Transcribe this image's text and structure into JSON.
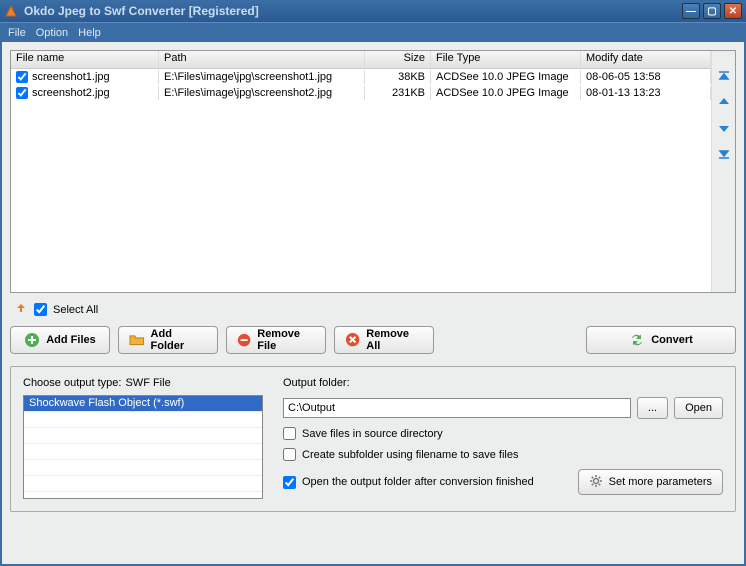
{
  "title": "Okdo Jpeg to Swf Converter [Registered]",
  "menu": {
    "file": "File",
    "option": "Option",
    "help": "Help"
  },
  "table": {
    "headers": {
      "name": "File name",
      "path": "Path",
      "size": "Size",
      "type": "File Type",
      "date": "Modify date"
    },
    "rows": [
      {
        "checked": true,
        "name": "screenshot1.jpg",
        "path": "E:\\Files\\image\\jpg\\screenshot1.jpg",
        "size": "38KB",
        "type": "ACDSee 10.0 JPEG Image",
        "date": "08-06-05 13:58"
      },
      {
        "checked": true,
        "name": "screenshot2.jpg",
        "path": "E:\\Files\\image\\jpg\\screenshot2.jpg",
        "size": "231KB",
        "type": "ACDSee 10.0 JPEG Image",
        "date": "08-01-13 13:23"
      }
    ]
  },
  "selectAll": {
    "label": "Select All",
    "checked": true
  },
  "buttons": {
    "addFiles": "Add Files",
    "addFolder": "Add Folder",
    "removeFile": "Remove File",
    "removeAll": "Remove All",
    "convert": "Convert"
  },
  "outputType": {
    "label": "Choose output type:",
    "current": "SWF File",
    "option": "Shockwave Flash Object (*.swf)"
  },
  "outputFolder": {
    "label": "Output folder:",
    "value": "C:\\Output",
    "browse": "...",
    "open": "Open"
  },
  "options": {
    "saveSource": {
      "label": "Save files in source directory",
      "checked": false
    },
    "subfolder": {
      "label": "Create subfolder using filename to save files",
      "checked": false
    },
    "openAfter": {
      "label": "Open the output folder after conversion finished",
      "checked": true
    }
  },
  "moreParams": "Set more parameters"
}
